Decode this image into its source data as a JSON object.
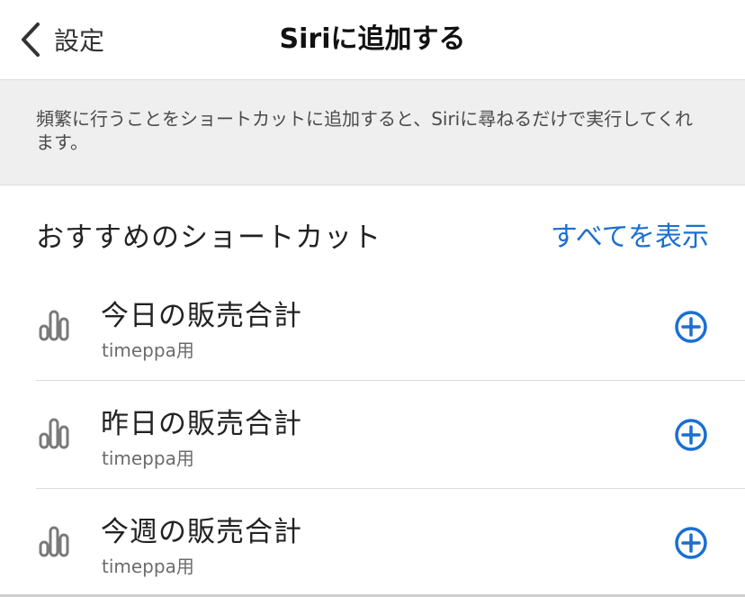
{
  "navbar": {
    "back_label": "設定",
    "title": "Siriに追加する"
  },
  "banner": {
    "text": "頻繁に行うことをショートカットに追加すると、Siriに尋ねるだけで実行してくれます。"
  },
  "section": {
    "title": "おすすめのショートカット",
    "see_all_label": "すべてを表示"
  },
  "shortcuts": [
    {
      "title": "今日の販売合計",
      "subtitle": "timeppa用",
      "icon": "bar-chart-icon"
    },
    {
      "title": "昨日の販売合計",
      "subtitle": "timeppa用",
      "icon": "bar-chart-icon"
    },
    {
      "title": "今週の販売合計",
      "subtitle": "timeppa用",
      "icon": "bar-chart-icon"
    }
  ],
  "colors": {
    "accent": "#1a6fd1",
    "banner_bg": "#efefef",
    "icon_gray": "#7a7a7a"
  }
}
